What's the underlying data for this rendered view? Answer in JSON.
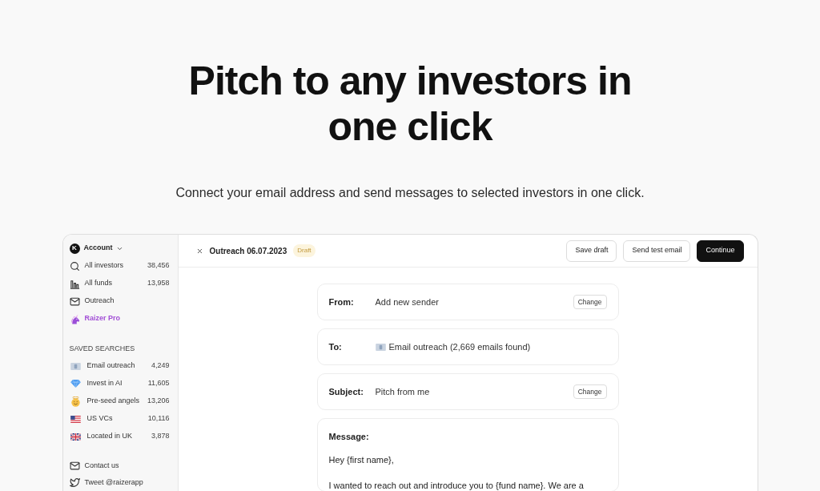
{
  "hero": {
    "title": "Pitch to any investors in one click",
    "subtitle": "Connect your email address and send messages to selected investors in one click."
  },
  "sidebar": {
    "account": {
      "initial": "K",
      "label": "Account"
    },
    "nav": [
      {
        "kind": "link",
        "label": "All investors",
        "count": "38,456"
      },
      {
        "kind": "link",
        "label": "All funds",
        "count": "13,958"
      },
      {
        "kind": "link",
        "label": "Outreach"
      },
      {
        "kind": "promo",
        "label": "Raizer Pro"
      }
    ],
    "saved_searches": {
      "heading": "SAVED SEARCHES",
      "items": [
        {
          "label": "Email outreach",
          "count": "4,249"
        },
        {
          "label": "Invest in AI",
          "count": "11,605"
        },
        {
          "label": "Pre-seed angels",
          "count": "13,206"
        },
        {
          "label": "US VCs",
          "count": "10,116"
        },
        {
          "label": "Located in UK",
          "count": "3,878"
        }
      ]
    },
    "footer": [
      {
        "label": "Contact us"
      },
      {
        "label": "Tweet @raizerapp"
      }
    ]
  },
  "toolbar": {
    "title": "Outreach 06.07.2023",
    "badge": "Draft",
    "buttons": [
      {
        "kind": "secondary",
        "label": "Save draft"
      },
      {
        "kind": "secondary",
        "label": "Send test email"
      },
      {
        "kind": "primary",
        "label": "Continue"
      }
    ]
  },
  "fields": [
    {
      "kind": "text",
      "label": "From:",
      "value": "Add new sender",
      "action": "Change"
    },
    {
      "kind": "list",
      "label": "To:",
      "value": "Email outreach (2,669 emails found)"
    },
    {
      "kind": "text",
      "label": "Subject:",
      "value": "Pitch from me",
      "action": "Change"
    },
    {
      "kind": "message",
      "label": "Message:",
      "lines": [
        "Hey {first name},",
        "I wanted to reach out and introduce you to {fund name}. We are a"
      ]
    }
  ]
}
